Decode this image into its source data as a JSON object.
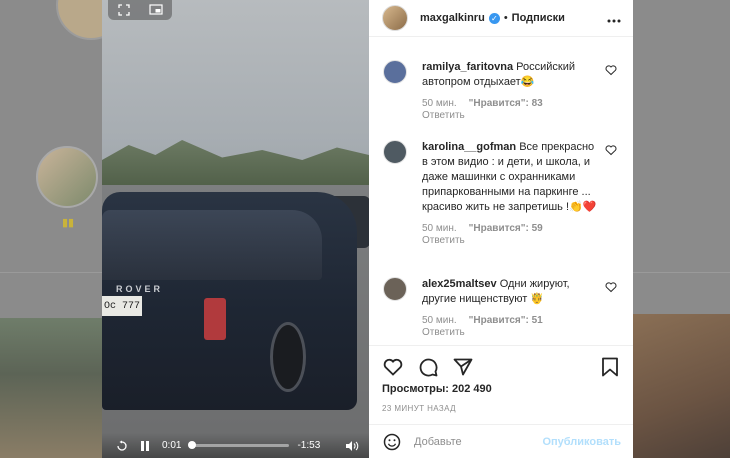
{
  "post": {
    "username": "maxgalkinru",
    "separator": "•",
    "follow_label": "Подписки",
    "more": "•••"
  },
  "video": {
    "current_time": "0:01",
    "remaining_time": "-1:53",
    "progress": 0.01,
    "plate_text": "Ос 777",
    "brand_text": "ROVER"
  },
  "comments": [
    {
      "username": "ramilya_faritovna",
      "text": "Российский автопром отдыхает😂",
      "time": "50 мин.",
      "likes": "\"Нравится\": 83",
      "reply": "Ответить",
      "avatar_color": "#5a6f9c"
    },
    {
      "username": "karolina__gofman",
      "text": "Все прекрасно в этом видио : и дети, и школа, и даже машинки с охранниками припаркованными на паркинге ... красиво жить не запретишь !👏❤️",
      "time": "50 мин.",
      "likes": "\"Нравится\": 59",
      "reply": "Ответить",
      "avatar_color": "#4f5a62"
    },
    {
      "username": "alex25maltsev",
      "text": "Одни жируют, другие нищенствуют 🤴",
      "time": "50 мин.",
      "likes": "\"Нравится\": 51",
      "reply": "Ответить",
      "avatar_color": "#6b6258"
    }
  ],
  "actions": {
    "views": "Просмотры: 202 490",
    "timestamp": "23 МИНУТ НАЗАД"
  },
  "add_comment": {
    "placeholder": "Добавьте",
    "publish_label": "Опубликовать"
  },
  "colors": {
    "verified": "#3897f0",
    "publish_disabled": "#b2dffc",
    "muted_text": "#8e8e8e"
  },
  "icons": {
    "video_top": [
      "expand-icon",
      "picture-in-picture-icon"
    ],
    "video_bar": [
      "replay-icon",
      "pause-icon",
      "volume-icon"
    ],
    "actions": [
      "heart-icon",
      "comment-icon",
      "share-icon",
      "bookmark-icon"
    ]
  }
}
